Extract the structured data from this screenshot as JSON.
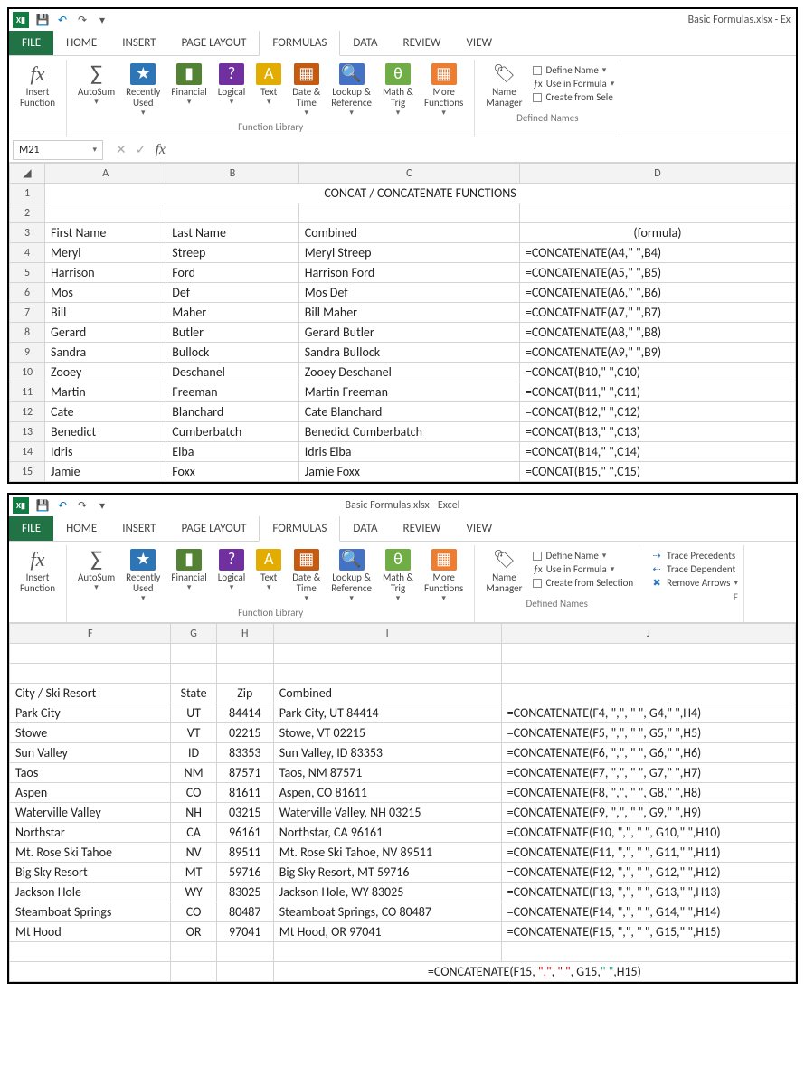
{
  "app": {
    "title1": "Basic Formulas.xlsx - Ex",
    "title2": "Basic Formulas.xlsx - Excel"
  },
  "menu": {
    "file": "FILE",
    "home": "HOME",
    "insert": "INSERT",
    "pagelayout": "PAGE LAYOUT",
    "formulas": "FORMULAS",
    "data": "DATA",
    "review": "REVIEW",
    "view": "VIEW"
  },
  "ribbon": {
    "insert_fn": "Insert\nFunction",
    "autosum": "AutoSum",
    "recent": "Recently\nUsed",
    "financial": "Financial",
    "logical": "Logical",
    "text": "Text",
    "datetime": "Date &\nTime",
    "lookup": "Lookup &\nReference",
    "mathtrig": "Math &\nTrig",
    "more": "More\nFunctions",
    "fn_library": "Function Library",
    "name_mgr": "Name\nManager",
    "define": "Define Name",
    "usein": "Use in Formula",
    "createfrom": "Create from Sele",
    "createfrom2": "Create from Selection",
    "defined_names": "Defined Names",
    "trace_prec": "Trace Precedents",
    "trace_dep": "Trace Dependent",
    "remove_arrows": "Remove Arrows",
    "fa_letter": "F"
  },
  "namebox": "M21",
  "sheet1": {
    "cols": [
      "A",
      "B",
      "C",
      "D"
    ],
    "title": "CONCAT / CONCATENATE FUNCTIONS",
    "hdr": {
      "fn": "First Name",
      "ln": "Last Name",
      "comb": "Combined",
      "form": "(formula)"
    },
    "rows": [
      {
        "r": "4",
        "a": "Meryl",
        "b": "Streep",
        "c": "Meryl Streep",
        "d": "=CONCATENATE(A4,\" \",B4)"
      },
      {
        "r": "5",
        "a": "Harrison",
        "b": "Ford",
        "c": "Harrison Ford",
        "d": "=CONCATENATE(A5,\" \",B5)"
      },
      {
        "r": "6",
        "a": "Mos",
        "b": "Def",
        "c": "Mos Def",
        "d": "=CONCATENATE(A6,\" \",B6)"
      },
      {
        "r": "7",
        "a": "Bill",
        "b": "Maher",
        "c": "Bill Maher",
        "d": "=CONCATENATE(A7,\" \",B7)"
      },
      {
        "r": "8",
        "a": "Gerard",
        "b": "Butler",
        "c": "Gerard Butler",
        "d": "=CONCATENATE(A8,\" \",B8)"
      },
      {
        "r": "9",
        "a": "Sandra",
        "b": "Bullock",
        "c": "Sandra Bullock",
        "d": "=CONCATENATE(A9,\" \",B9)"
      },
      {
        "r": "10",
        "a": "Zooey",
        "b": "Deschanel",
        "c": "Zooey Deschanel",
        "d": "=CONCAT(B10,\" \",C10)"
      },
      {
        "r": "11",
        "a": "Martin",
        "b": "Freeman",
        "c": "Martin Freeman",
        "d": "=CONCAT(B11,\" \",C11)"
      },
      {
        "r": "12",
        "a": "Cate",
        "b": "Blanchard",
        "c": "Cate Blanchard",
        "d": "=CONCAT(B12,\" \",C12)"
      },
      {
        "r": "13",
        "a": "Benedict",
        "b": "Cumberbatch",
        "c": "Benedict Cumberbatch",
        "d": "=CONCAT(B13,\" \",C13)"
      },
      {
        "r": "14",
        "a": "Idris",
        "b": "Elba",
        "c": "Idris Elba",
        "d": "=CONCAT(B14,\" \",C14)"
      },
      {
        "r": "15",
        "a": "Jamie",
        "b": "Foxx",
        "c": "Jamie Foxx",
        "d": "=CONCAT(B15,\" \",C15)"
      }
    ]
  },
  "sheet2": {
    "cols": [
      "F",
      "G",
      "H",
      "I",
      "J"
    ],
    "hdr": {
      "city": "City / Ski Resort",
      "state": "State",
      "zip": "Zip",
      "comb": "Combined"
    },
    "rows": [
      {
        "f": "Park City",
        "g": "UT",
        "h": "84414",
        "i": "Park City, UT 84414",
        "j": "=CONCATENATE(F4, \",\", \" \", G4,\" \",H4)"
      },
      {
        "f": "Stowe",
        "g": "VT",
        "h": "02215",
        "i": "Stowe, VT 02215",
        "j": "=CONCATENATE(F5, \",\", \" \", G5,\" \",H5)"
      },
      {
        "f": "Sun Valley",
        "g": "ID",
        "h": "83353",
        "i": "Sun Valley, ID 83353",
        "j": "=CONCATENATE(F6, \",\", \" \", G6,\" \",H6)"
      },
      {
        "f": "Taos",
        "g": "NM",
        "h": "87571",
        "i": "Taos, NM 87571",
        "j": "=CONCATENATE(F7, \",\", \" \", G7,\" \",H7)"
      },
      {
        "f": "Aspen",
        "g": "CO",
        "h": "81611",
        "i": "Aspen, CO 81611",
        "j": "=CONCATENATE(F8, \",\", \" \", G8,\" \",H8)"
      },
      {
        "f": "Waterville Valley",
        "g": "NH",
        "h": "03215",
        "i": "Waterville Valley, NH 03215",
        "j": "=CONCATENATE(F9, \",\", \" \", G9,\" \",H9)"
      },
      {
        "f": "Northstar",
        "g": "CA",
        "h": "96161",
        "i": "Northstar, CA 96161",
        "j": "=CONCATENATE(F10, \",\", \" \", G10,\" \",H10)"
      },
      {
        "f": "Mt. Rose Ski Tahoe",
        "g": "NV",
        "h": "89511",
        "i": "Mt. Rose Ski Tahoe, NV 89511",
        "j": "=CONCATENATE(F11, \",\", \" \", G11,\" \",H11)"
      },
      {
        "f": "Big Sky Resort",
        "g": "MT",
        "h": "59716",
        "i": "Big Sky Resort, MT 59716",
        "j": "=CONCATENATE(F12, \",\", \" \", G12,\" \",H12)"
      },
      {
        "f": "Jackson Hole",
        "g": "WY",
        "h": "83025",
        "i": "Jackson Hole, WY 83025",
        "j": "=CONCATENATE(F13, \",\", \" \", G13,\" \",H13)"
      },
      {
        "f": "Steamboat Springs",
        "g": "CO",
        "h": "80487",
        "i": "Steamboat Springs, CO 80487",
        "j": "=CONCATENATE(F14, \",\", \" \", G14,\" \",H14)"
      },
      {
        "f": "Mt Hood",
        "g": "OR",
        "h": "97041",
        "i": "Mt Hood, OR 97041",
        "j": "=CONCATENATE(F15, \",\", \" \", G15,\" \",H15)"
      }
    ],
    "formula_color": {
      "pre": "=CONCATENATE(F15, ",
      "c1": "\",\"",
      "mid": ", ",
      "c2": "\" \"",
      "mid2": ", G15,",
      "c3": "\" \"",
      "post": ",H15)"
    }
  }
}
